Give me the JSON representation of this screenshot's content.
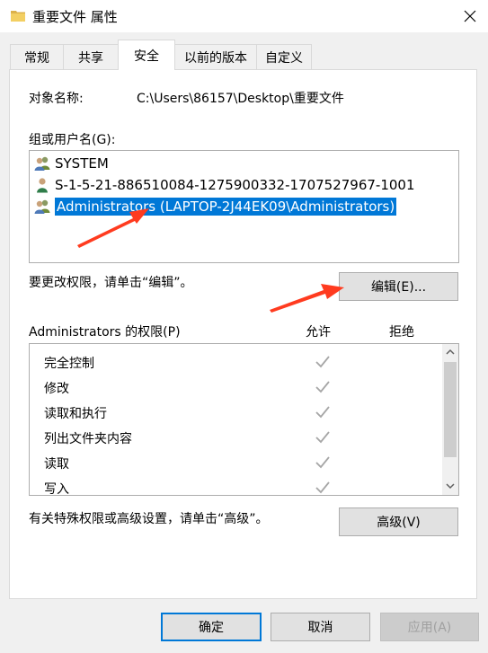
{
  "window": {
    "title": "重要文件 属性",
    "close_glyph": "✕"
  },
  "tabs": [
    {
      "label": "常规",
      "active": false
    },
    {
      "label": "共享",
      "active": false
    },
    {
      "label": "安全",
      "active": true
    },
    {
      "label": "以前的版本",
      "active": false
    },
    {
      "label": "自定义",
      "active": false
    }
  ],
  "security": {
    "object_label": "对象名称:",
    "object_value": "C:\\Users\\86157\\Desktop\\重要文件",
    "group_label": "组或用户名(G):",
    "users": [
      {
        "name": "SYSTEM",
        "icon": "user-group-icon",
        "selected": false
      },
      {
        "name": "S-1-5-21-886510084-1275900332-1707527967-1001",
        "icon": "user-icon",
        "selected": false
      },
      {
        "name": "Administrators (LAPTOP-2J44EK09\\Administrators)",
        "icon": "user-group-icon",
        "selected": true
      }
    ],
    "change_hint": "要更改权限，请单击“编辑”。",
    "edit_button": "编辑(E)...",
    "perm_title": "Administrators 的权限(P)",
    "allow_header": "允许",
    "deny_header": "拒绝",
    "permissions": [
      {
        "name": "完全控制",
        "allow": true,
        "deny": false
      },
      {
        "name": "修改",
        "allow": true,
        "deny": false
      },
      {
        "name": "读取和执行",
        "allow": true,
        "deny": false
      },
      {
        "name": "列出文件夹内容",
        "allow": true,
        "deny": false
      },
      {
        "name": "读取",
        "allow": true,
        "deny": false
      },
      {
        "name": "写入",
        "allow": true,
        "deny": false
      }
    ],
    "advanced_hint": "有关特殊权限或高级设置，请单击“高级”。",
    "advanced_button": "高级(V)"
  },
  "footer": {
    "ok": "确定",
    "cancel": "取消",
    "apply": "应用(A)"
  },
  "colors": {
    "selection": "#0078d7",
    "annotation_arrow": "#ff3b1f"
  }
}
